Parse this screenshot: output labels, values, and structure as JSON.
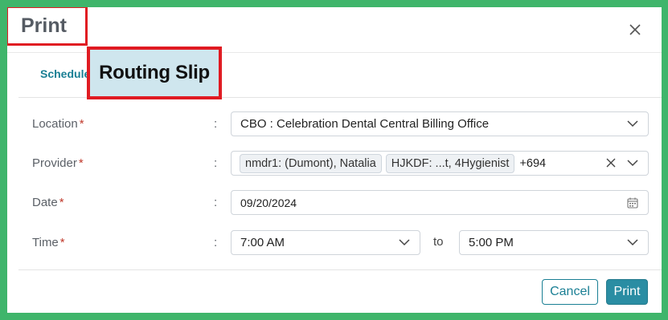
{
  "dialog": {
    "title": "Print",
    "close_icon": "close-icon"
  },
  "tabs": {
    "schedule_label": "Schedule",
    "routing_slip_label": "Routing Slip"
  },
  "form": {
    "location": {
      "label": "Location",
      "required": "*",
      "colon": ":",
      "value": "CBO : Celebration Dental Central Billing Office"
    },
    "provider": {
      "label": "Provider",
      "required": "*",
      "colon": ":",
      "chips": [
        "nmdr1: (Dumont), Natalia",
        "HJKDF: ...t, 4Hygienist"
      ],
      "more": "+694"
    },
    "date": {
      "label": "Date",
      "required": "*",
      "colon": ":",
      "value": "09/20/2024",
      "icon": "calendar-icon"
    },
    "time": {
      "label": "Time",
      "required": "*",
      "colon": ":",
      "from": "7:00 AM",
      "to_label": "to",
      "to": "5:00 PM"
    }
  },
  "footer": {
    "cancel_label": "Cancel",
    "print_label": "Print"
  },
  "colors": {
    "frame": "#3fb56b",
    "highlight": "#e01b22",
    "accent": "#1a7f94",
    "primary_button": "#2a8da3"
  }
}
